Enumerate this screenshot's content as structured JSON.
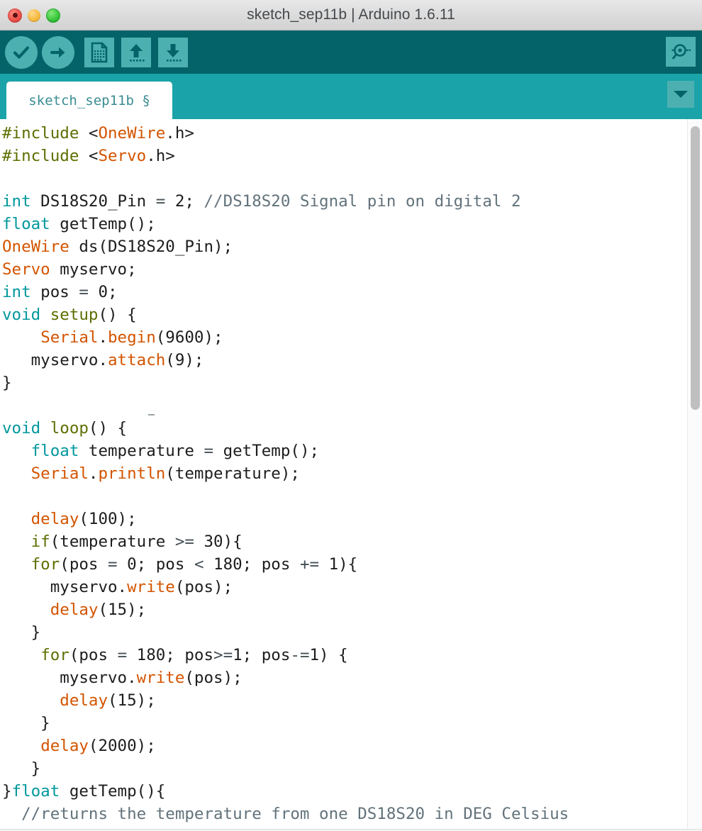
{
  "window": {
    "title": "sketch_sep11b | Arduino 1.6.11",
    "controls": [
      {
        "name": "close",
        "label": ""
      },
      {
        "name": "minimize",
        "label": ""
      },
      {
        "name": "maximize",
        "label": ""
      }
    ]
  },
  "toolbar": {
    "background": "#046368",
    "button_bg": "#4cb0b1",
    "buttons": [
      {
        "icon": "verify-checkmark-icon",
        "tooltip": "Verify"
      },
      {
        "icon": "upload-arrow-icon",
        "tooltip": "Upload"
      },
      {
        "icon": "new-file-icon",
        "tooltip": "New"
      },
      {
        "icon": "open-folder-arrow-up-icon",
        "tooltip": "Open"
      },
      {
        "icon": "save-arrow-down-icon",
        "tooltip": "Save"
      }
    ],
    "serial_monitor": {
      "icon": "magnifier-serial-monitor-icon",
      "tooltip": "Serial Monitor"
    }
  },
  "tab_bar": {
    "background": "#1aa3a8",
    "active_tab": "sketch_sep11b §",
    "menu_button_icon": "chevron-down-icon"
  },
  "editor": {
    "font_size_px": 22.5,
    "colors": {
      "keyword_type": "#00979c",
      "function": "#5e6e00",
      "library": "#d35400",
      "comment": "#62727b",
      "text": "#1d1d1d",
      "background": "#ffffff"
    },
    "lines": [
      "#include <OneWire.h>",
      "#include <Servo.h>",
      "",
      "int DS18S20_Pin = 2; //DS18S20 Signal pin on digital 2",
      "float getTemp();",
      "OneWire ds(DS18S20_Pin);",
      "Servo myservo;",
      "int pos = 0;",
      "void setup() {",
      "    Serial.begin(9600);",
      "   myservo.attach(9);",
      "}",
      "",
      "void loop() {",
      "   float temperature = getTemp();",
      "   Serial.println(temperature);",
      "",
      "   delay(100);",
      "   if(temperature >= 30){",
      "   for(pos = 0; pos < 180; pos += 1){",
      "     myservo.write(pos);",
      "     delay(15);",
      "   }",
      "    for(pos = 180; pos>=1; pos-=1) {",
      "      myservo.write(pos);",
      "      delay(15);",
      "    }",
      "    delay(2000);",
      "   }",
      "}float getTemp(){",
      "  //returns the temperature from one DS18S20 in DEG Celsius"
    ]
  },
  "scrollbar": {
    "orientation": "vertical",
    "thumb_color": "#bfbfbf",
    "track_color": "#fbfbfb"
  }
}
